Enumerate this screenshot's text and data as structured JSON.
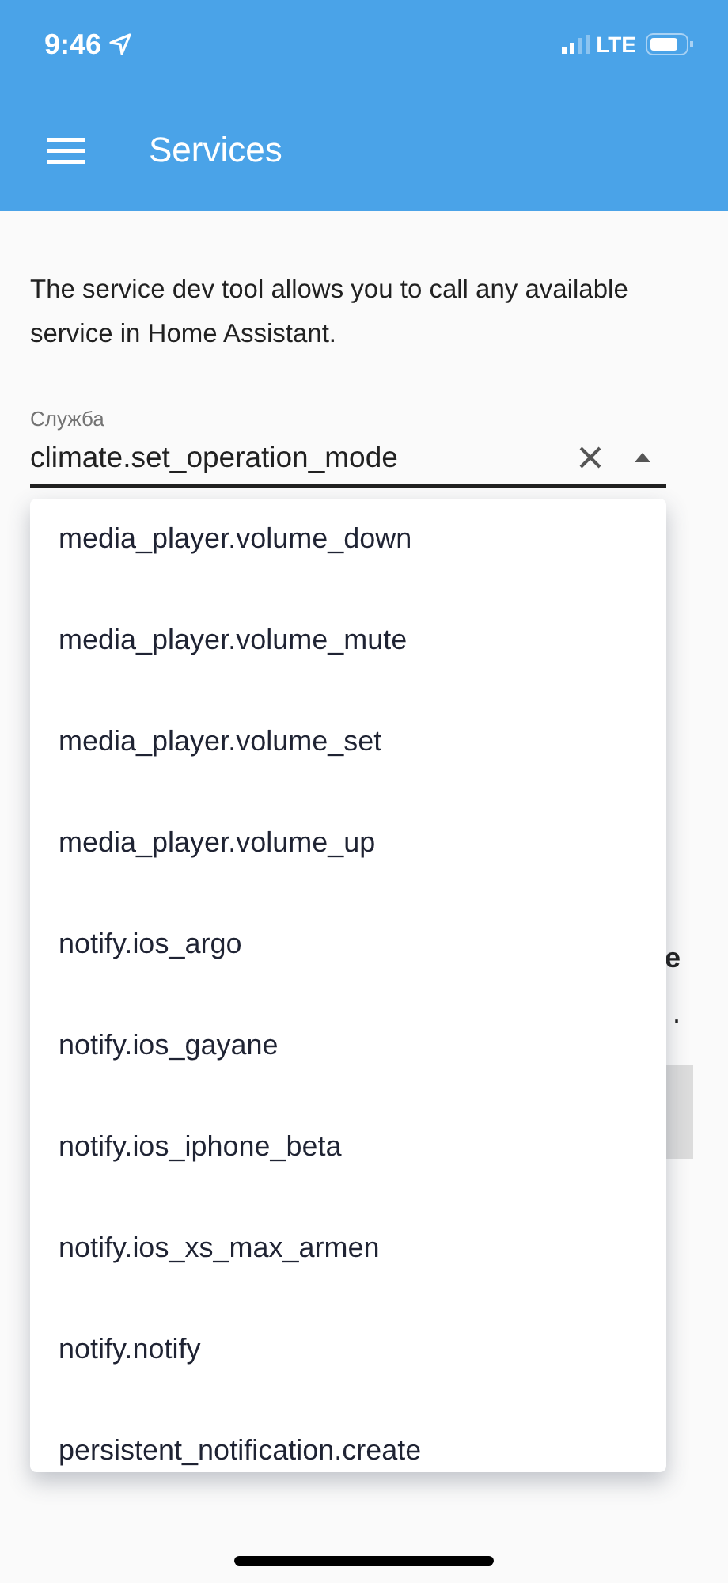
{
  "status_bar": {
    "time": "9:46",
    "network": "LTE"
  },
  "toolbar": {
    "title": "Services"
  },
  "description": "The service dev tool allows you to call any available service in Home Assistant.",
  "service_field": {
    "label": "Служба",
    "value": "climate.set_operation_mode",
    "expanded": true
  },
  "dropdown": {
    "items": [
      {
        "label": "media_player.volume_down"
      },
      {
        "label": "media_player.volume_mute"
      },
      {
        "label": "media_player.volume_set"
      },
      {
        "label": "media_player.volume_up"
      },
      {
        "label": "notify.ios_argo"
      },
      {
        "label": "notify.ios_gayane"
      },
      {
        "label": "notify.ios_iphone_beta"
      },
      {
        "label": "notify.ios_xs_max_armen"
      },
      {
        "label": "notify.notify"
      },
      {
        "label": "persistent_notification.create"
      }
    ]
  },
  "hidden_text": [
    {
      "kind": "bold",
      "text": "e"
    },
    {
      "kind": "plain",
      "text": "."
    }
  ]
}
